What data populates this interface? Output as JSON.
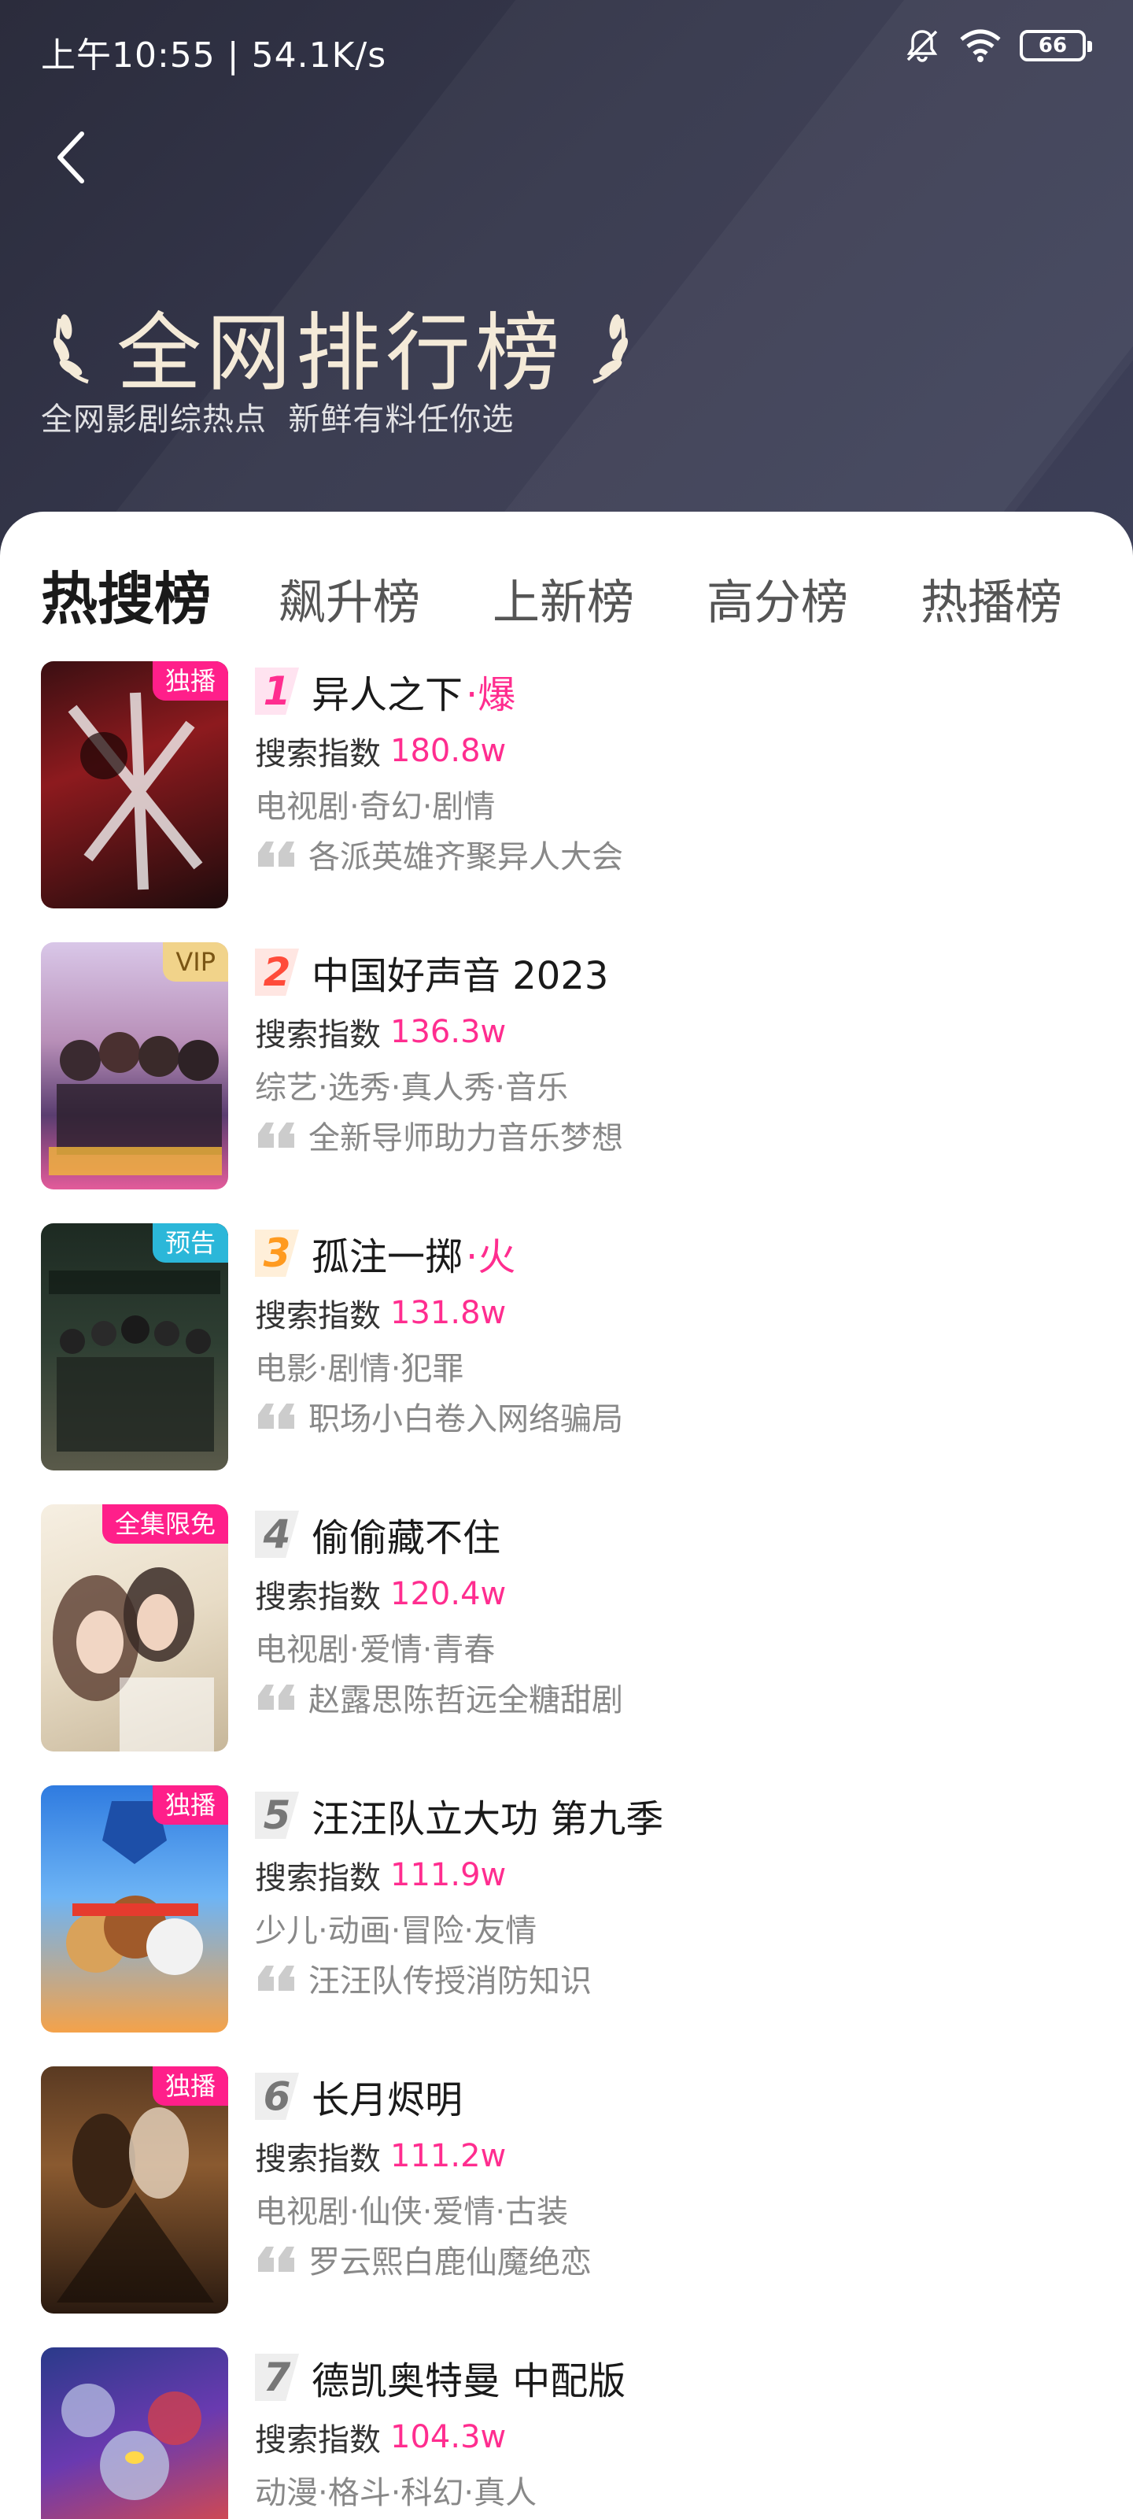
{
  "status_bar": {
    "time": "上午10:55 | 54.1K/s",
    "battery": "66"
  },
  "header": {
    "title": "全网排行榜",
    "subtitle": "全网影剧综热点  新鲜有料任你选"
  },
  "tabs": [
    "热搜榜",
    "飙升榜",
    "上新榜",
    "高分榜",
    "热播榜"
  ],
  "list": {
    "score_label": "搜索指数",
    "items": [
      {
        "rank": "1",
        "title": "异人之下",
        "hot": "·爆",
        "score": "180.8w",
        "genres": "电视剧·奇幻·剧情",
        "desc": "各派英雄齐聚异人大会",
        "tag": "独播"
      },
      {
        "rank": "2",
        "title": "中国好声音 2023",
        "hot": "",
        "score": "136.3w",
        "genres": "综艺·选秀·真人秀·音乐",
        "desc": "全新导师助力音乐梦想",
        "tag": "VIP"
      },
      {
        "rank": "3",
        "title": "孤注一掷",
        "hot": "·火",
        "score": "131.8w",
        "genres": "电影·剧情·犯罪",
        "desc": "职场小白卷入网络骗局",
        "tag": "预告"
      },
      {
        "rank": "4",
        "title": "偷偷藏不住",
        "hot": "",
        "score": "120.4w",
        "genres": "电视剧·爱情·青春",
        "desc": "赵露思陈哲远全糖甜剧",
        "tag": "全集限免"
      },
      {
        "rank": "5",
        "title": "汪汪队立大功 第九季",
        "hot": "",
        "score": "111.9w",
        "genres": "少儿·动画·冒险·友情",
        "desc": "汪汪队传授消防知识",
        "tag": "独播"
      },
      {
        "rank": "6",
        "title": "长月烬明",
        "hot": "",
        "score": "111.2w",
        "genres": "电视剧·仙侠·爱情·古装",
        "desc": "罗云熙白鹿仙魔绝恋",
        "tag": "独播"
      },
      {
        "rank": "7",
        "title": "德凯奥特曼 中配版",
        "hot": "",
        "score": "104.3w",
        "genres": "动漫·格斗·科幻·真人",
        "desc": "",
        "tag": ""
      }
    ]
  },
  "colors": {
    "accent": "#ff2d8f",
    "rank1": "#ff2d8f",
    "rank2": "#ff4b3a",
    "rank3": "#ff9a1f",
    "rank_other": "#777777",
    "tag_pink": "#ff1f8a",
    "tag_vip": "#f1d38a",
    "tag_preview": "#2bb7d9"
  }
}
